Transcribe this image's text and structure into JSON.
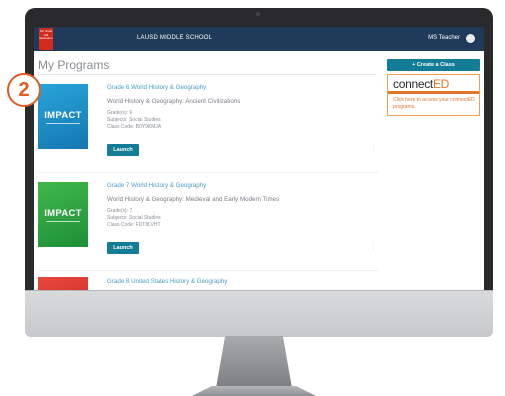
{
  "annotation": {
    "step_number": "2"
  },
  "header": {
    "logo_text": "Mc Graw Hill Education",
    "school_name": "LAUSD MIDDLE SCHOOL",
    "user_name": "MS Teacher"
  },
  "main": {
    "page_title": "My Programs",
    "programs": [
      {
        "thumbnail_word": "IMPACT",
        "thumbnail_color": "#1f8fc8",
        "title": "Grade 6 World History & Geography",
        "description": "World History & Geography: Ancient Civilizations",
        "grade": "Grade(s): 6",
        "subjects": "Subjects: Social Studies",
        "class_code": "Class Code: B0Y9KMJA",
        "launch_label": "Launch"
      },
      {
        "thumbnail_word": "IMPACT",
        "thumbnail_color": "#2fa442",
        "title": "Grade 7 World History & Geography",
        "description": "World History & Geography: Medieval and Early Modern Times",
        "grade": "Grade(s): 7",
        "subjects": "Subjects: Social Studies",
        "class_code": "Class Code: FDT8LVHT",
        "launch_label": "Launch"
      },
      {
        "thumbnail_color": "#d8342b",
        "title": "Grade 8 United States History & Geography"
      }
    ]
  },
  "sidebar": {
    "create_class_label": "+ Create a Class",
    "connected": {
      "logo_main": "connect",
      "logo_accent": "ED",
      "text": "Click here to access your connectED programs."
    }
  },
  "colors": {
    "header_bg": "#1f3b59",
    "button_teal": "#137d97",
    "link_blue": "#4a9ec9",
    "connected_orange": "#e4762b",
    "annotation_orange": "#e15a22"
  }
}
